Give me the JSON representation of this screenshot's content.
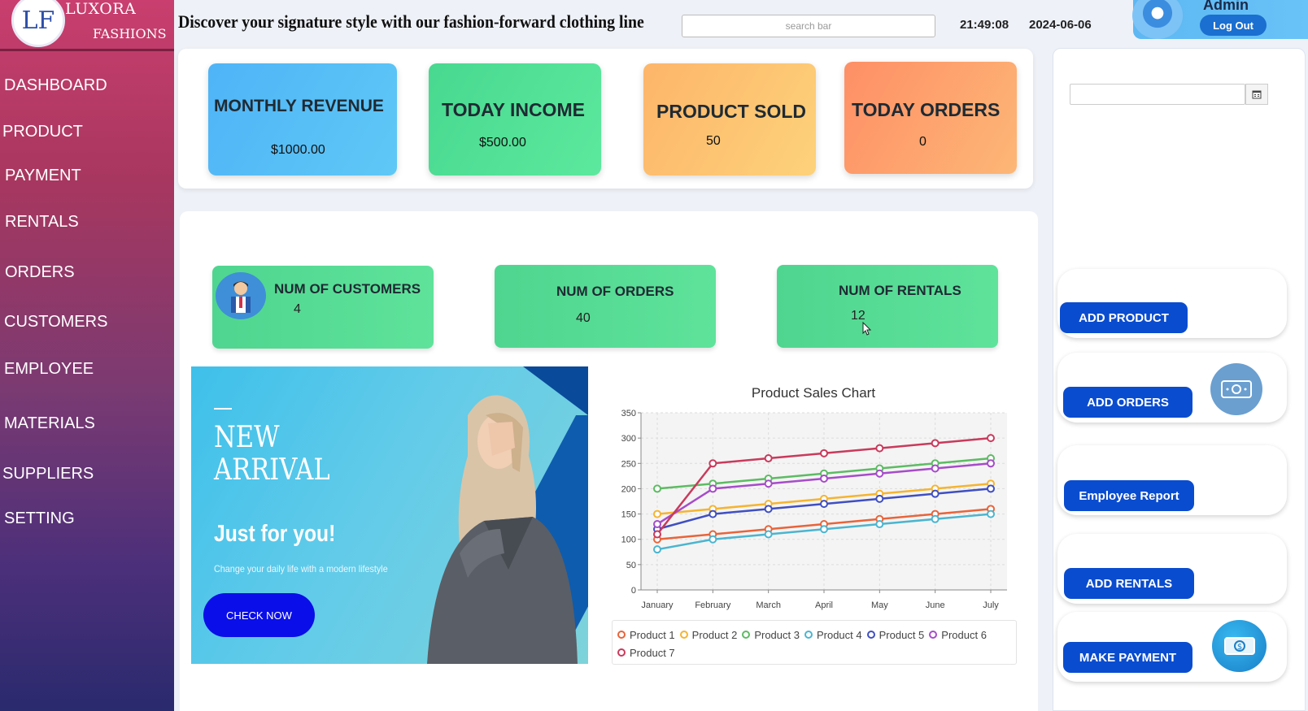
{
  "brand": {
    "logo_text": "LF",
    "name_line1": "LUXORA",
    "name_line2": "FASHIONS"
  },
  "sidebar": {
    "items": [
      {
        "label": "DASHBOARD"
      },
      {
        "label": "PRODUCT"
      },
      {
        "label": "PAYMENT"
      },
      {
        "label": "RENTALS"
      },
      {
        "label": "ORDERS"
      },
      {
        "label": "CUSTOMERS"
      },
      {
        "label": "EMPLOYEE"
      },
      {
        "label": "MATERIALS"
      },
      {
        "label": "SUPPLIERS"
      },
      {
        "label": "SETTING"
      }
    ]
  },
  "header": {
    "tagline": "Discover your signature style with our fashion-forward clothing line",
    "search_placeholder": "search bar",
    "time": "21:49:08",
    "date": "2024-06-06",
    "user_label": "Admin",
    "logout_label": "Log Out"
  },
  "stats": {
    "monthly_revenue": {
      "title": "MONTHLY REVENUE",
      "value": "$1000.00"
    },
    "today_income": {
      "title": "TODAY INCOME",
      "value": "$500.00"
    },
    "product_sold": {
      "title": "PRODUCT SOLD",
      "value": "50"
    },
    "today_orders": {
      "title": "TODAY ORDERS",
      "value": "0"
    }
  },
  "counts": {
    "customers": {
      "title": "NUM OF CUSTOMERS",
      "value": "4"
    },
    "orders": {
      "title": "NUM OF ORDERS",
      "value": "40"
    },
    "rentals": {
      "title": "NUM OF RENTALS",
      "value": "12"
    }
  },
  "banner": {
    "headline": "NEW ARRIVAL",
    "headline_line1": "NEW",
    "headline_line2": "ARRIVAL",
    "tagline": "Just for you!",
    "subtitle": "Change your daily life with a modern lifestyle",
    "cta_label": "CHECK NOW"
  },
  "actions": {
    "add_product": "ADD  PRODUCT",
    "add_orders": "ADD ORDERS",
    "employee_report": "Employee Report",
    "add_rentals": "ADD RENTALS",
    "make_payment": "MAKE PAYMENT"
  },
  "colors": {
    "sidebar_top": "#c93e6e",
    "sidebar_bottom": "#2a2a6e",
    "stat_revenue": "#4fb4f7",
    "stat_income": "#4fdc94",
    "stat_sold": "#fdc26a",
    "stat_orders": "#fe9a67",
    "count_card": "#4fd58f",
    "action_button": "#0a4ccf"
  },
  "chart_data": {
    "type": "line",
    "title": "Product Sales Chart",
    "categories": [
      "January",
      "February",
      "March",
      "April",
      "May",
      "June",
      "July"
    ],
    "ylim": [
      0,
      350
    ],
    "yticks": [
      0,
      50,
      100,
      150,
      200,
      250,
      300,
      350
    ],
    "grid": true,
    "legend_position": "bottom",
    "series": [
      {
        "name": "Product 1",
        "color": "#e8643a",
        "values": [
          100,
          110,
          120,
          130,
          140,
          150,
          160
        ]
      },
      {
        "name": "Product 2",
        "color": "#f5b431",
        "values": [
          150,
          160,
          170,
          180,
          190,
          200,
          210
        ]
      },
      {
        "name": "Product 3",
        "color": "#5dbb63",
        "values": [
          200,
          210,
          220,
          230,
          240,
          250,
          260
        ]
      },
      {
        "name": "Product 4",
        "color": "#4bb5cf",
        "values": [
          80,
          100,
          110,
          120,
          130,
          140,
          150
        ]
      },
      {
        "name": "Product 5",
        "color": "#3f4fc1",
        "values": [
          120,
          150,
          160,
          170,
          180,
          190,
          200
        ]
      },
      {
        "name": "Product 6",
        "color": "#a64cc9",
        "values": [
          130,
          200,
          210,
          220,
          230,
          240,
          250
        ]
      },
      {
        "name": "Product 7",
        "color": "#c93a5c",
        "values": [
          110,
          250,
          260,
          270,
          280,
          290,
          300
        ]
      }
    ]
  }
}
